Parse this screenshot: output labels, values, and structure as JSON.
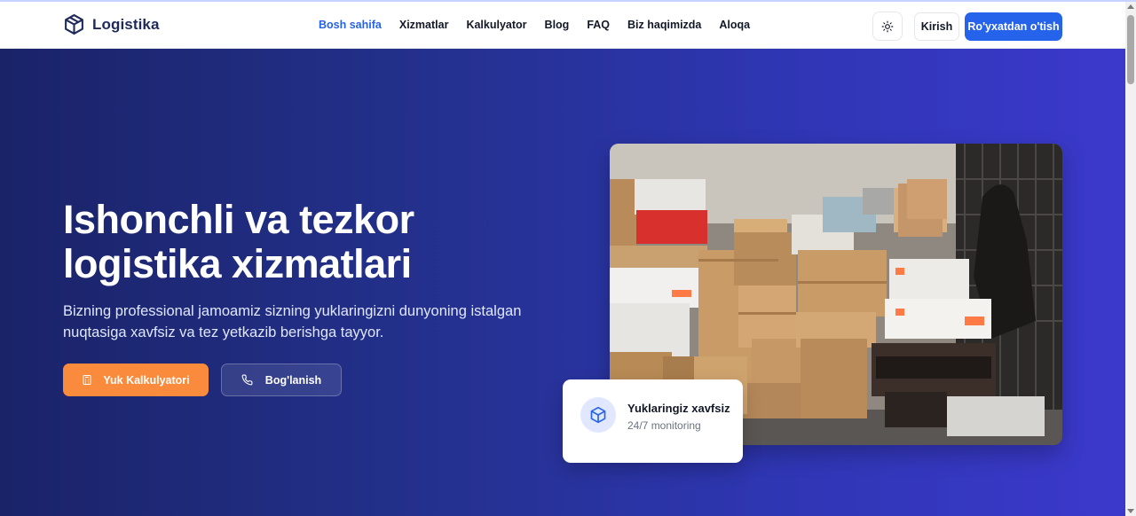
{
  "brand": {
    "name": "Logistika",
    "icon": "box-icon"
  },
  "nav": {
    "links": [
      {
        "label": "Bosh sahifa",
        "active": true
      },
      {
        "label": "Xizmatlar",
        "active": false
      },
      {
        "label": "Kalkulyator",
        "active": false
      },
      {
        "label": "Blog",
        "active": false
      },
      {
        "label": "FAQ",
        "active": false
      },
      {
        "label": "Biz haqimizda",
        "active": false
      },
      {
        "label": "Aloqa",
        "active": false
      }
    ],
    "theme_icon": "sun-icon",
    "login_label": "Kirish",
    "signup_label": "Ro'yxatdan o'tish"
  },
  "hero": {
    "title_line1": "Ishonchli va tezkor",
    "title_line2": "logistika xizmatlari",
    "subtitle": "Bizning professional jamoamiz sizning yuklaringizni dunyoning istalgan nuqtasiga xavfsiz va tez yetkazib berishga tayyor.",
    "primary_button": {
      "label": "Yuk Kalkulyatori",
      "icon": "calculator-icon"
    },
    "secondary_button": {
      "label": "Bog'lanish",
      "icon": "phone-icon"
    },
    "image": "warehouse-boxes-photo"
  },
  "card": {
    "title": "Yuklaringiz xavfsiz",
    "subtitle": "24/7 monitoring",
    "icon": "package-icon"
  },
  "colors": {
    "primary": "#2563eb",
    "accent": "#fb8b3c",
    "hero_start": "#1a2368",
    "hero_end": "#3b39cc",
    "brand_text": "#1e2a5a"
  }
}
